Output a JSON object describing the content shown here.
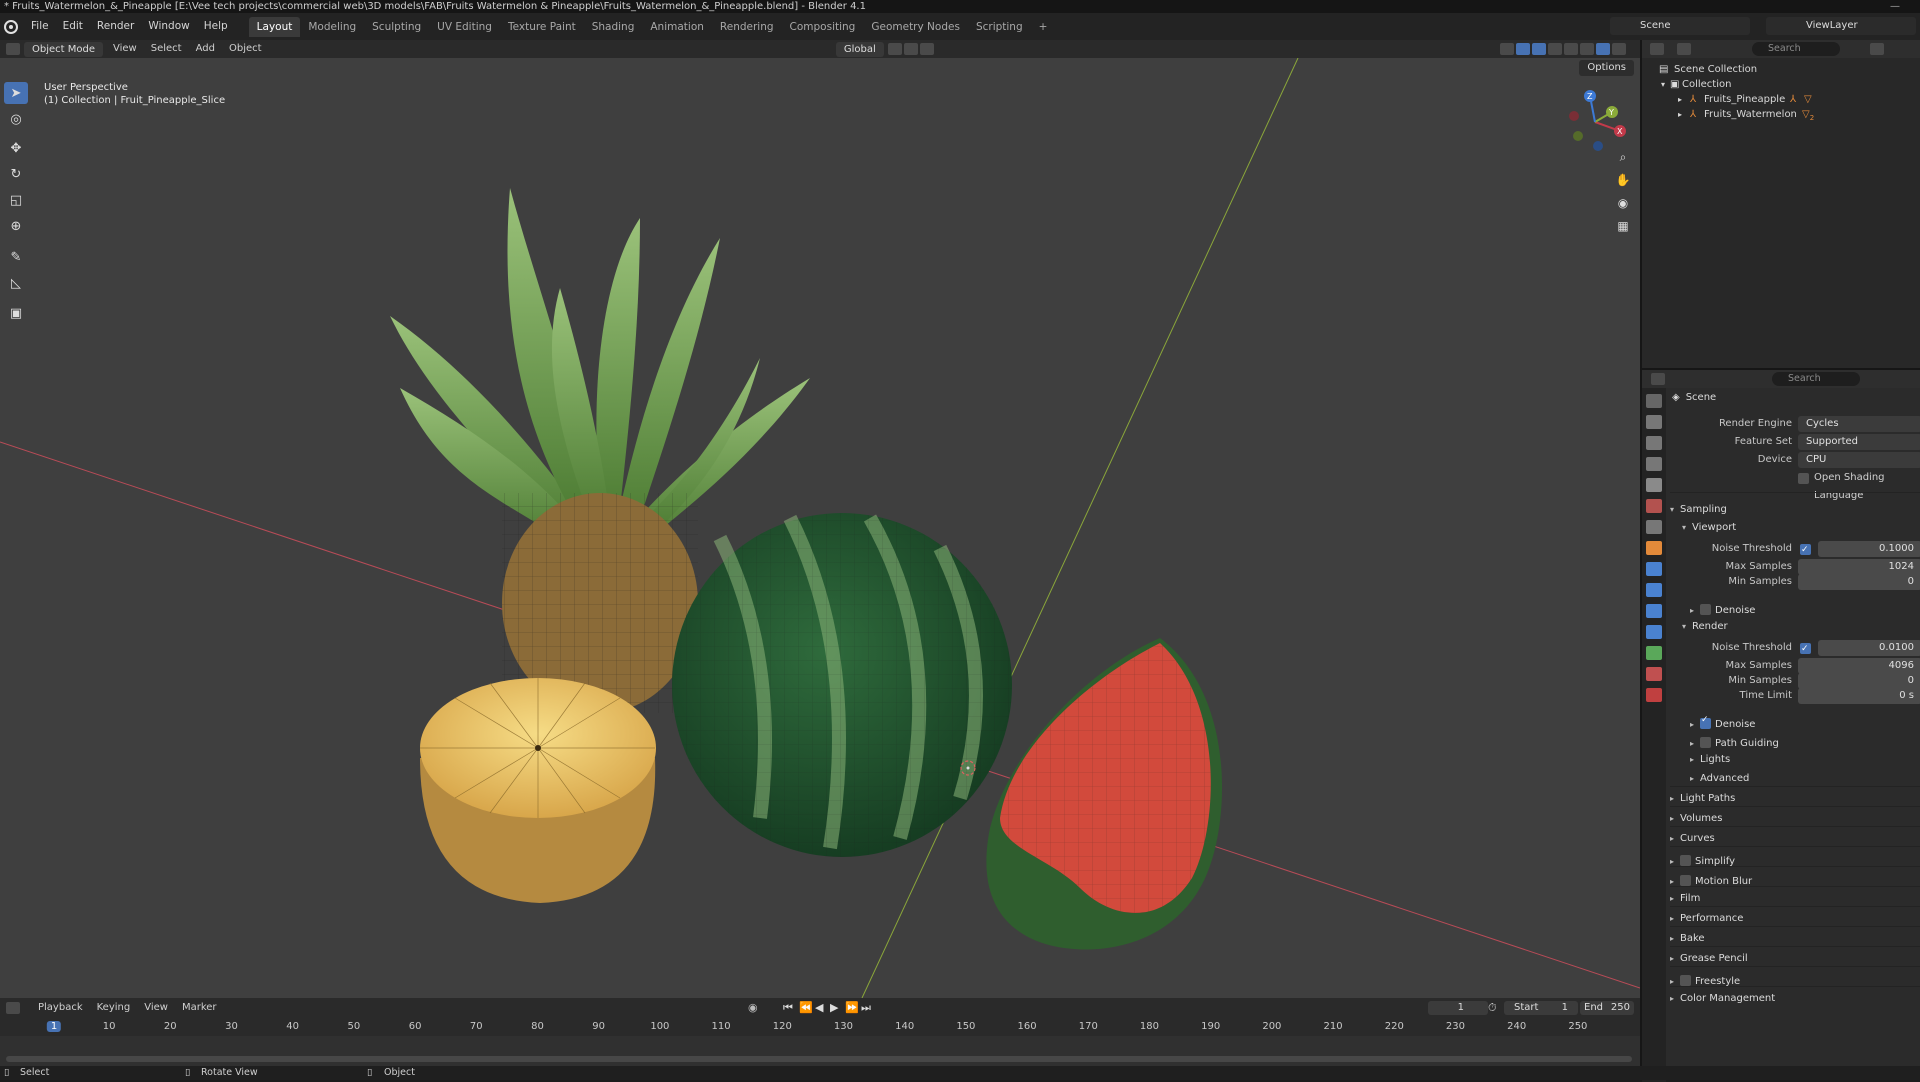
{
  "window": {
    "title": "* Fruits_Watermelon_&_Pineapple [E:\\Vee tech projects\\commercial web\\3D models\\FAB\\Fruits Watermelon & Pineapple\\Fruits_Watermelon_&_Pineapple.blend] - Blender 4.1",
    "minimize": "—"
  },
  "menubar": {
    "items": [
      "File",
      "Edit",
      "Render",
      "Window",
      "Help"
    ],
    "workspaces": [
      "Layout",
      "Modeling",
      "Sculpting",
      "UV Editing",
      "Texture Paint",
      "Shading",
      "Animation",
      "Rendering",
      "Compositing",
      "Geometry Nodes",
      "Scripting"
    ],
    "active_workspace": "Layout",
    "add_tab": "+",
    "scene": "Scene",
    "view_layer": "ViewLayer"
  },
  "viewport_header": {
    "mode": "Object Mode",
    "menus": [
      "View",
      "Select",
      "Add",
      "Object"
    ],
    "transform_orientation": "Global",
    "options": "Options"
  },
  "viewport": {
    "view_name": "User Perspective",
    "context": "(1) Collection | Fruit_Pineapple_Slice",
    "gizmo_axes": [
      "X",
      "Y",
      "Z"
    ]
  },
  "outliner": {
    "search_placeholder": "Search",
    "scene_collection": "Scene Collection",
    "collection": "Collection",
    "objects": [
      "Fruits_Pineapple",
      "Fruits_Watermelon"
    ],
    "badge_counts": [
      "2"
    ]
  },
  "properties": {
    "search_placeholder": "Search",
    "context": "Scene",
    "render_engine_label": "Render Engine",
    "render_engine": "Cycles",
    "feature_set_label": "Feature Set",
    "feature_set": "Supported",
    "device_label": "Device",
    "device": "CPU",
    "osl_label": "Open Shading Language",
    "sampling": "Sampling",
    "viewport": "Viewport",
    "noise_threshold_label": "Noise Threshold",
    "vp_noise_threshold": "0.1000",
    "max_samples_label": "Max Samples",
    "vp_max_samples": "1024",
    "min_samples_label": "Min Samples",
    "vp_min_samples": "0",
    "denoise": "Denoise",
    "render": "Render",
    "r_noise_threshold": "0.0100",
    "r_max_samples": "4096",
    "r_min_samples": "0",
    "time_limit_label": "Time Limit",
    "r_time_limit": "0 s",
    "path_guiding": "Path Guiding",
    "lights": "Lights",
    "advanced": "Advanced",
    "sections": [
      "Light Paths",
      "Volumes",
      "Curves",
      "Simplify",
      "Motion Blur",
      "Film",
      "Performance",
      "Bake",
      "Grease Pencil",
      "Freestyle",
      "Color Management"
    ]
  },
  "timeline": {
    "menus": [
      "Playback",
      "Keying",
      "View",
      "Marker"
    ],
    "current_frame": "1",
    "start_label": "Start",
    "start": "1",
    "end_label": "End",
    "end": "250",
    "ticks": [
      "1",
      "10",
      "20",
      "30",
      "40",
      "50",
      "60",
      "70",
      "80",
      "90",
      "100",
      "110",
      "120",
      "130",
      "140",
      "150",
      "160",
      "170",
      "180",
      "190",
      "200",
      "210",
      "220",
      "230",
      "240",
      "250"
    ]
  },
  "statusbar": {
    "select": "Select",
    "rotate": "Rotate View",
    "object": "Object"
  },
  "colors": {
    "accent": "#4772b3",
    "viewport_bg": "#3f3f3f",
    "x_axis": "#c23a4a",
    "y_axis": "#8bab3a",
    "z_axis": "#3d7ad6"
  }
}
